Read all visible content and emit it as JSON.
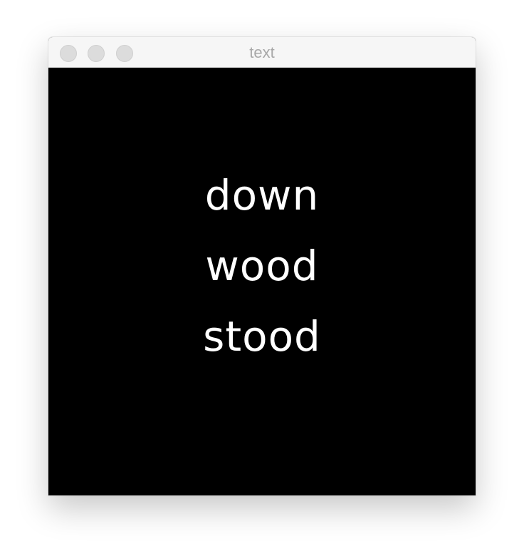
{
  "window": {
    "title": "text",
    "background_color": "#000000",
    "text_color": "#ffffff"
  },
  "canvas": {
    "words": [
      "down",
      "wood",
      "stood"
    ]
  }
}
